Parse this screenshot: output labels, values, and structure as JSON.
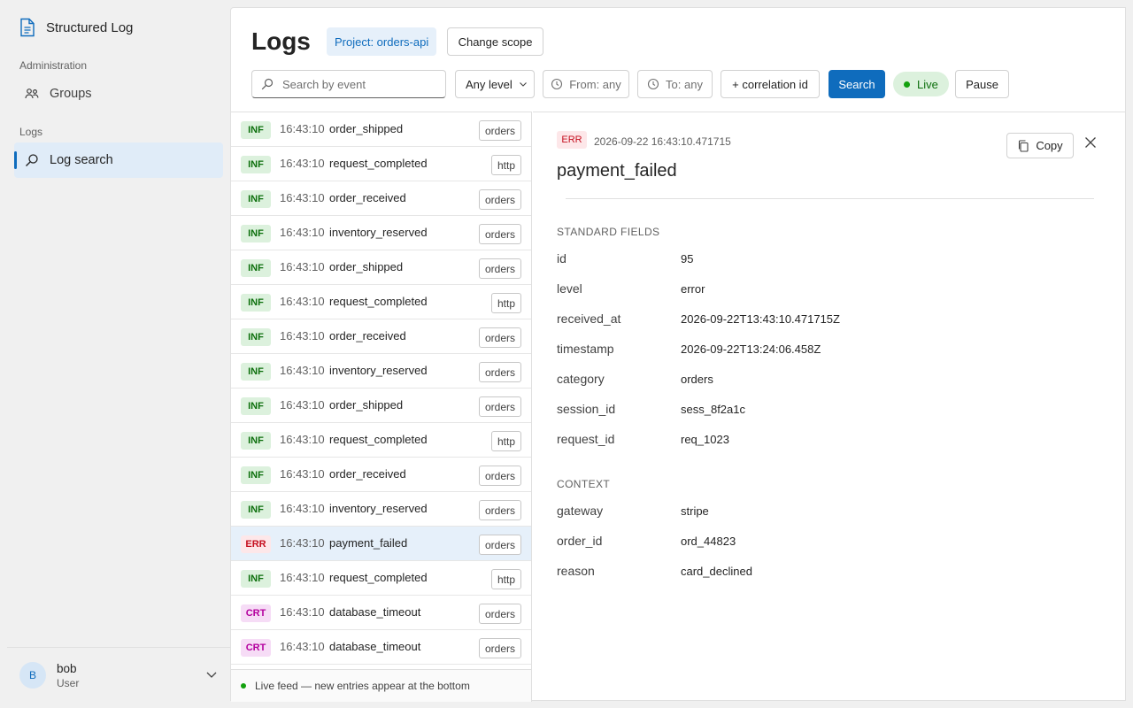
{
  "app": {
    "name": "Structured Log"
  },
  "sidebar": {
    "sections": [
      {
        "label": "Administration",
        "items": [
          {
            "label": "Groups",
            "icon": "people-icon"
          }
        ]
      },
      {
        "label": "Logs",
        "items": [
          {
            "label": "Log search",
            "icon": "search-icon",
            "active": true
          }
        ]
      }
    ]
  },
  "user": {
    "initial": "B",
    "name": "bob",
    "role": "User"
  },
  "header": {
    "title": "Logs",
    "project_chip": "Project: orders-api",
    "change_scope": "Change scope"
  },
  "filters": {
    "search_placeholder": "Search by event",
    "level": "Any level",
    "from": "From: any",
    "to": "To: any",
    "correlation": "+ correlation id",
    "search_button": "Search",
    "live_label": "Live",
    "pause_button": "Pause"
  },
  "rows": [
    {
      "level": "INF",
      "time": "16:43:10",
      "event": "order_shipped",
      "tag": "orders"
    },
    {
      "level": "INF",
      "time": "16:43:10",
      "event": "request_completed",
      "tag": "http"
    },
    {
      "level": "INF",
      "time": "16:43:10",
      "event": "order_received",
      "tag": "orders"
    },
    {
      "level": "INF",
      "time": "16:43:10",
      "event": "inventory_reserved",
      "tag": "orders"
    },
    {
      "level": "INF",
      "time": "16:43:10",
      "event": "order_shipped",
      "tag": "orders"
    },
    {
      "level": "INF",
      "time": "16:43:10",
      "event": "request_completed",
      "tag": "http"
    },
    {
      "level": "INF",
      "time": "16:43:10",
      "event": "order_received",
      "tag": "orders"
    },
    {
      "level": "INF",
      "time": "16:43:10",
      "event": "inventory_reserved",
      "tag": "orders"
    },
    {
      "level": "INF",
      "time": "16:43:10",
      "event": "order_shipped",
      "tag": "orders"
    },
    {
      "level": "INF",
      "time": "16:43:10",
      "event": "request_completed",
      "tag": "http"
    },
    {
      "level": "INF",
      "time": "16:43:10",
      "event": "order_received",
      "tag": "orders"
    },
    {
      "level": "INF",
      "time": "16:43:10",
      "event": "inventory_reserved",
      "tag": "orders"
    },
    {
      "level": "ERR",
      "time": "16:43:10",
      "event": "payment_failed",
      "tag": "orders",
      "selected": true
    },
    {
      "level": "INF",
      "time": "16:43:10",
      "event": "request_completed",
      "tag": "http"
    },
    {
      "level": "CRT",
      "time": "16:43:10",
      "event": "database_timeout",
      "tag": "orders"
    },
    {
      "level": "CRT",
      "time": "16:43:10",
      "event": "database_timeout",
      "tag": "orders"
    }
  ],
  "list_footer": "Live feed — new entries appear at the bottom",
  "detail": {
    "level": "ERR",
    "timestamp": "2026-09-22 16:43:10.471715",
    "title": "payment_failed",
    "copy_label": "Copy",
    "standard_label": "STANDARD FIELDS",
    "standard": [
      {
        "key": "id",
        "value": "95"
      },
      {
        "key": "level",
        "value": "error"
      },
      {
        "key": "received_at",
        "value": "2026-09-22T13:43:10.471715Z"
      },
      {
        "key": "timestamp",
        "value": "2026-09-22T13:24:06.458Z"
      },
      {
        "key": "category",
        "value": "orders"
      },
      {
        "key": "session_id",
        "value": "sess_8f2a1c"
      },
      {
        "key": "request_id",
        "value": "req_1023"
      }
    ],
    "context_label": "CONTEXT",
    "context": [
      {
        "key": "gateway",
        "value": "stripe"
      },
      {
        "key": "order_id",
        "value": "ord_44823"
      },
      {
        "key": "reason",
        "value": "card_declined"
      }
    ]
  },
  "colors": {
    "accent": "#0f6cbd",
    "info": "#0e700e",
    "error": "#c50f1f",
    "critical": "#b4009e"
  }
}
